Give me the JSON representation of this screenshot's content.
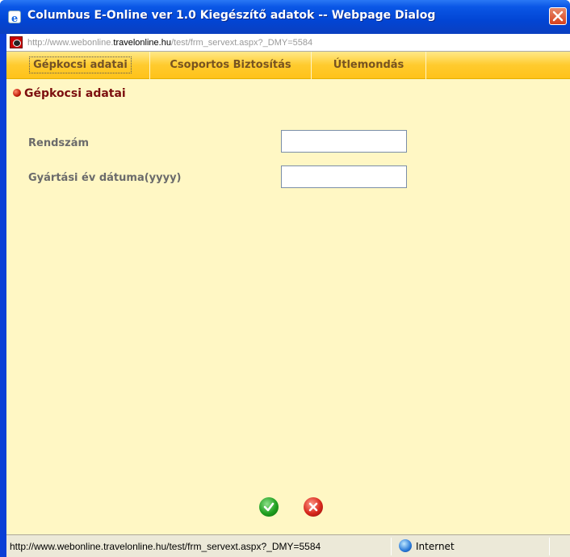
{
  "window": {
    "title": "Columbus E-Online ver 1.0 Kiegészítő adatok -- Webpage Dialog"
  },
  "address": {
    "prefix": "http://www.webonline.",
    "host": "travelonline.hu",
    "path": "/test/frm_servext.aspx?_DMY=5584"
  },
  "tabs": [
    {
      "label": "Gépkocsi adatai"
    },
    {
      "label": "Csoportos Biztosítás"
    },
    {
      "label": "Útlemondás"
    }
  ],
  "section": {
    "title": "Gépkocsi adatai"
  },
  "form": {
    "rendszam_label": "Rendszám",
    "rendszam_value": "",
    "gyartasi_ev_label": "Gyártási év dátuma(yyyy)",
    "gyartasi_ev_value": ""
  },
  "statusbar": {
    "url": "http://www.webonline.travelonline.hu/test/frm_servext.aspx?_DMY=5584",
    "zone": "Internet"
  },
  "colors": {
    "content_bg": "#fff7c4",
    "tab_bar": "#ffcb2e",
    "section_title": "#7c0f0f"
  },
  "icons": [
    "ie-icon",
    "close-icon",
    "page-icon",
    "bullet-icon",
    "ok-icon",
    "cancel-icon",
    "globe-icon"
  ]
}
